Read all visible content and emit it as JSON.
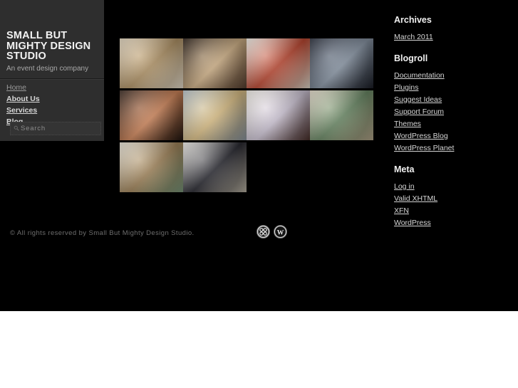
{
  "colors": {
    "page_background": "#000000",
    "sidebar_background": "#2e2e2e",
    "link": "#d6d6d6",
    "heading": "#f0f0f0",
    "muted": "#6e6e6e",
    "tagline": "#a8a8a8",
    "outside_page": "#ffffff"
  },
  "site": {
    "title": "SMALL BUT MIGHTY DESIGN STUDIO",
    "tagline": "An event design company"
  },
  "nav": {
    "items": [
      {
        "label": "Home",
        "current": true
      },
      {
        "label": "About Us",
        "current": false
      },
      {
        "label": "Services",
        "current": false
      },
      {
        "label": "Blog",
        "current": false
      }
    ]
  },
  "search": {
    "placeholder": "Search",
    "value": "",
    "icon": "search-icon"
  },
  "gallery": {
    "rows": [
      [
        {
          "alt": "Rows of escort cards laid out on a wooden table",
          "c1": "#e3d6bf",
          "c2": "#b99a6b",
          "c3": "#f0e7d6"
        },
        {
          "alt": "Two men in suits talking beside a cocktail table",
          "c1": "#2d2119",
          "c2": "#d9b98d",
          "c3": "#584031"
        },
        {
          "alt": "Box of bruschetta appetizers with tomato topping",
          "c1": "#f2efe8",
          "c2": "#c34a33",
          "c3": "#e8e2d4"
        },
        {
          "alt": "Outdoor terrace at dusk with mountain view",
          "c1": "#2a2f3c",
          "c2": "#8e9bab",
          "c3": "#1a1d26"
        }
      ],
      [
        {
          "alt": "Three women smiling together at the event",
          "c1": "#3a2a22",
          "c2": "#d98c5f",
          "c3": "#20150f"
        },
        {
          "alt": "Hanging glass votives against a mountain backdrop",
          "c1": "#b9c4cb",
          "c2": "#e6c98d",
          "c3": "#8e9aa4"
        },
        {
          "alt": "Wine bottle beside a floral printed welcome bag",
          "c1": "#f1eee7",
          "c2": "#d8cfe0",
          "c3": "#4a2f2a"
        },
        {
          "alt": "Linen table runner with a handwritten Keep Warm sign",
          "c1": "#e5dccb",
          "c2": "#6f8f6a",
          "c3": "#b8a98d"
        }
      ],
      [
        {
          "alt": "Baskets of blankets and framed artwork on easels",
          "c1": "#e8e3d6",
          "c2": "#a98b5f",
          "c3": "#7d9b7e"
        },
        {
          "alt": "Guest in a suit at a bright glass-walled venue",
          "c1": "#f3f1ec",
          "c2": "#2b2b33",
          "c3": "#c0b9a9"
        }
      ]
    ]
  },
  "widgets": [
    {
      "title": "Archives",
      "items": [
        "March 2011"
      ]
    },
    {
      "title": "Blogroll",
      "items": [
        "Documentation",
        "Plugins",
        "Suggest Ideas",
        "Support Forum",
        "Themes",
        "WordPress Blog",
        "WordPress Planet"
      ]
    },
    {
      "title": "Meta",
      "items": [
        "Log in",
        "Valid XHTML",
        "XFN",
        "WordPress"
      ]
    }
  ],
  "footer": {
    "copyright": "© All rights reserved by Small But Mighty Design Studio.",
    "badges": [
      {
        "name": "clover-badge-icon",
        "title": "Clover badge"
      },
      {
        "name": "wordpress-badge-icon",
        "title": "WordPress"
      }
    ]
  }
}
